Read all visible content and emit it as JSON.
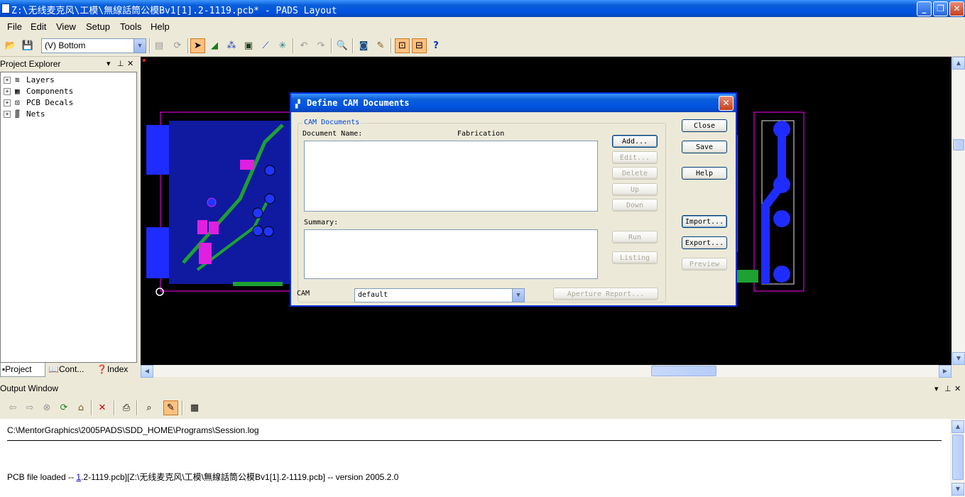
{
  "window": {
    "title": "Z:\\无线麦克风\\工模\\無線話筒公模Bv1[1].2-1119.pcb* - PADS Layout",
    "min": "_",
    "max": "❐",
    "close": "✕"
  },
  "menu": [
    "File",
    "Edit",
    "View",
    "Setup",
    "Tools",
    "Help"
  ],
  "toolbar": {
    "layer_combo": "(V) Bottom"
  },
  "project_explorer": {
    "title": "Project Explorer",
    "tree": [
      "Layers",
      "Components",
      "PCB Decals",
      "Nets"
    ],
    "tabs": [
      "Project",
      "Cont...",
      "Index"
    ]
  },
  "dialog": {
    "title": "Define CAM Documents",
    "group_label": "CAM Documents",
    "doc_name_label": "Document Name:",
    "fabrication_label": "Fabrication",
    "summary_label": "Summary:",
    "cam_label": "CAM",
    "cam_value": "default",
    "buttons": {
      "add": "Add...",
      "edit": "Edit...",
      "delete": "Delete",
      "up": "Up",
      "down": "Down",
      "run": "Run",
      "listing": "Listing",
      "aperture": "Aperture Report...",
      "close": "Close",
      "save": "Save",
      "help": "Help",
      "import": "Import...",
      "export": "Export...",
      "preview": "Preview"
    }
  },
  "output": {
    "title": "Output Window",
    "line1": "C:\\MentorGraphics\\2005PADS\\SDD_HOME\\Programs\\Session.log",
    "line2_prefix": "PCB file loaded -- ",
    "line2_link": "1",
    "line2_rest": ".2-1119.pcb][Z:\\无线麦克风\\工模\\無線話筒公模Bv1[1].2-1119.pcb]  -- version 2005.2.0"
  },
  "colors": {
    "pcb_background": "#000000",
    "copper_blue": "#1f2cff",
    "outline_magenta": "#d400d4",
    "trace_green": "#1ea032",
    "title_blue": "#0053e1"
  }
}
